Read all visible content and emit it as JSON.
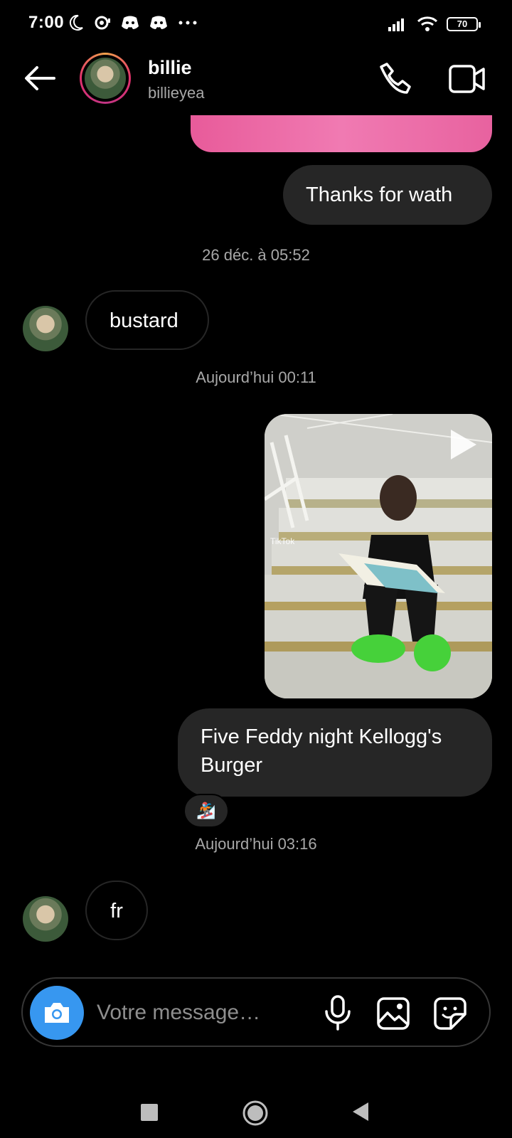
{
  "status_bar": {
    "time": "7:00",
    "battery": "70",
    "left_icons": [
      "moon-icon",
      "sync-icon",
      "discord-icon",
      "discord-icon",
      "more-icon"
    ],
    "right_icons": [
      "signal-icon",
      "wifi-icon",
      "battery-icon"
    ]
  },
  "header": {
    "name": "billie",
    "username": "billieyea",
    "back_icon": "arrow-left-icon",
    "call_icon": "phone-icon",
    "video_icon": "video-camera-icon"
  },
  "messages": {
    "m1_text": "Thanks for wath",
    "ts1": "26 déc. à 05:52",
    "m2_text": "bustard",
    "ts2": "Aujourd’hui 00:11",
    "video_overlay": "TikTok",
    "m3_text": "Five Feddy night Kellogg's Burger",
    "reaction": "🏂",
    "ts3": "Aujourd’hui 03:16",
    "m4_text": "fr"
  },
  "composer": {
    "placeholder": "Votre message…",
    "accent": "#3797f0"
  },
  "colors": {
    "background": "#000000",
    "bubble_out": "#262626",
    "secondary_text": "#a8a8a8"
  }
}
